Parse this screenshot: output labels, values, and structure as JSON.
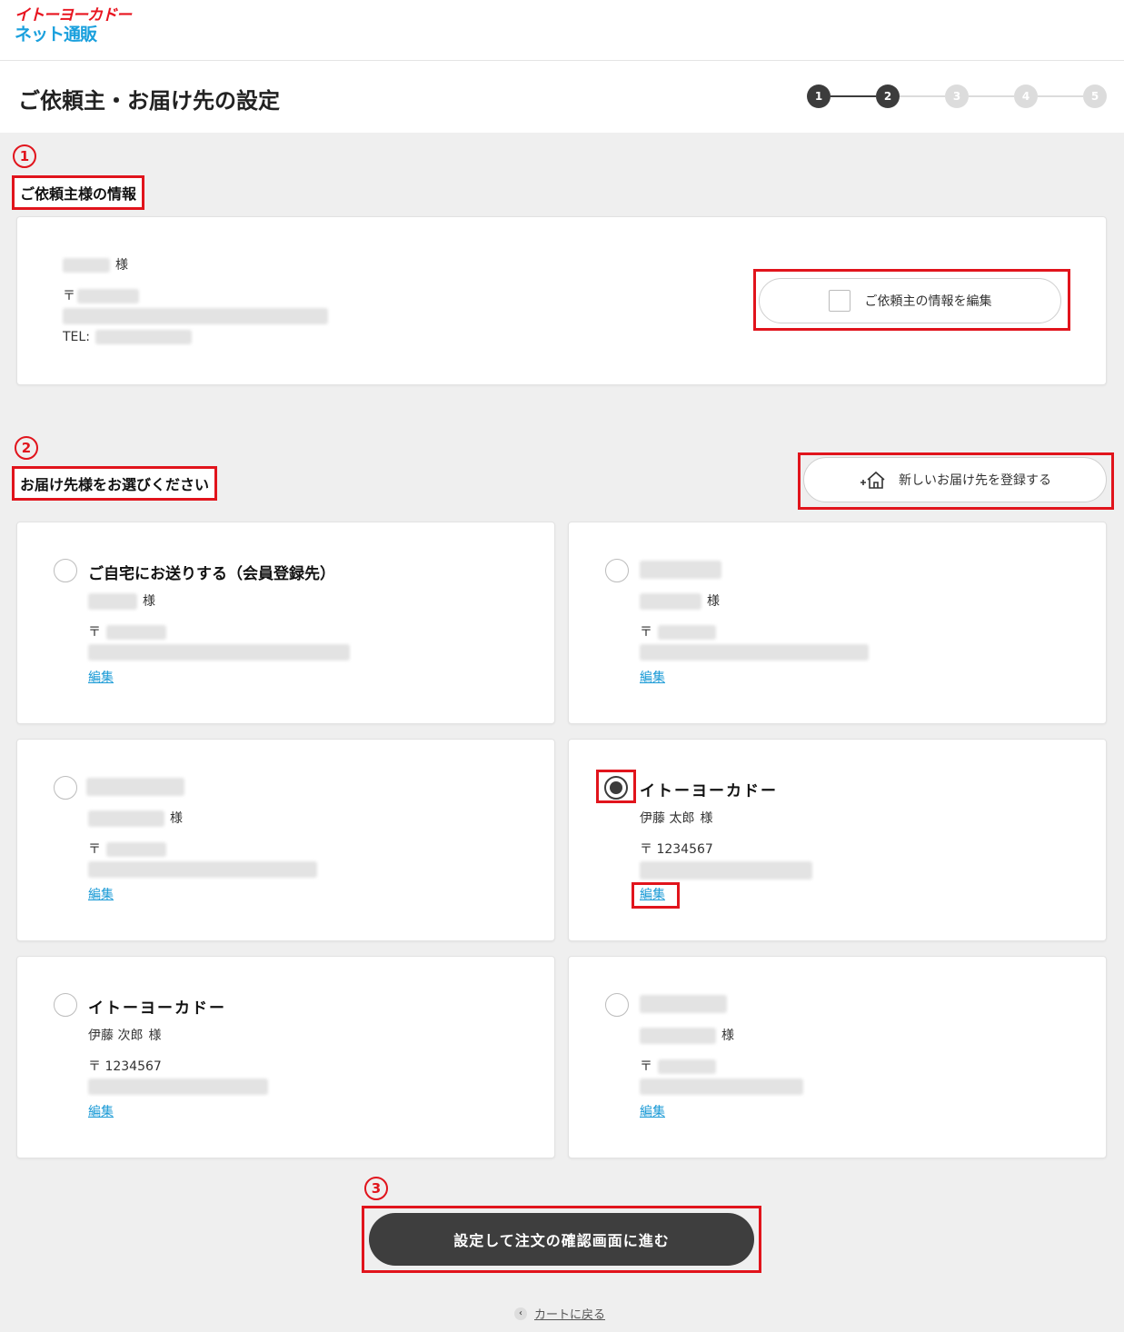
{
  "logo": {
    "line1": "イトーヨーカドー",
    "line2": "ネット通販"
  },
  "header": {
    "title": "ご依頼主・お届け先の設定"
  },
  "stepper": {
    "steps": [
      "1",
      "2",
      "3",
      "4",
      "5"
    ],
    "current": 2
  },
  "markers": [
    "1",
    "2",
    "3"
  ],
  "sender": {
    "section_label": "ご依頼主様の情報",
    "honorific": "様",
    "postal_symbol": "〒",
    "tel_label": "TEL:",
    "edit_button": "ご依頼主の情報を編集"
  },
  "delivery": {
    "section_label": "お届け先様をお選びください",
    "new_button": "新しいお届け先を登録する",
    "edit_label": "編集",
    "cards": [
      {
        "title": "ご自宅にお送りする（会員登録先）",
        "name": "",
        "honorific": "様",
        "postal": "",
        "selected": false
      },
      {
        "title": "",
        "name": "",
        "honorific": "様",
        "postal": "",
        "selected": false
      },
      {
        "title": "",
        "name": "",
        "honorific": "様",
        "postal": "",
        "selected": false
      },
      {
        "title": "イトーヨーカドー",
        "name": "伊藤 太郎",
        "honorific": "様",
        "postal": "1234567",
        "selected": true
      },
      {
        "title": "イトーヨーカドー",
        "name": "伊藤 次郎",
        "honorific": "様",
        "postal": "1234567",
        "selected": false
      },
      {
        "title": "",
        "name": "",
        "honorific": "様",
        "postal": "",
        "selected": false
      }
    ]
  },
  "postal_symbol": "〒",
  "submit_button": "設定して注文の確認画面に進む",
  "back_link": "カートに戻る",
  "colors": {
    "accent_red": "#e1141c",
    "dark": "#3c3c3c",
    "link": "#1a9ad6",
    "logo_red": "#e8141f",
    "logo_blue": "#1aa0dd"
  }
}
